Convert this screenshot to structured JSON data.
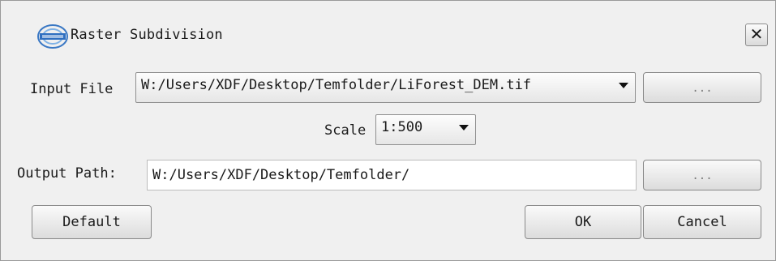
{
  "window": {
    "title": "Raster Subdivision",
    "close_glyph": "✕"
  },
  "input_file": {
    "label": "Input File",
    "value": "W:/Users/XDF/Desktop/Temfolder/LiForest_DEM.tif",
    "browse_label": "..."
  },
  "scale": {
    "label": "Scale",
    "value": "1:500"
  },
  "output_path": {
    "label": "Output Path:",
    "value": "W:/Users/XDF/Desktop/Temfolder/",
    "browse_label": "..."
  },
  "buttons": {
    "default_label": "Default",
    "ok_label": "OK",
    "cancel_label": "Cancel"
  },
  "icons": {
    "app_logo": "app-logo-icon",
    "dropdown_arrow": "chevron-down-icon",
    "close": "close-icon"
  }
}
